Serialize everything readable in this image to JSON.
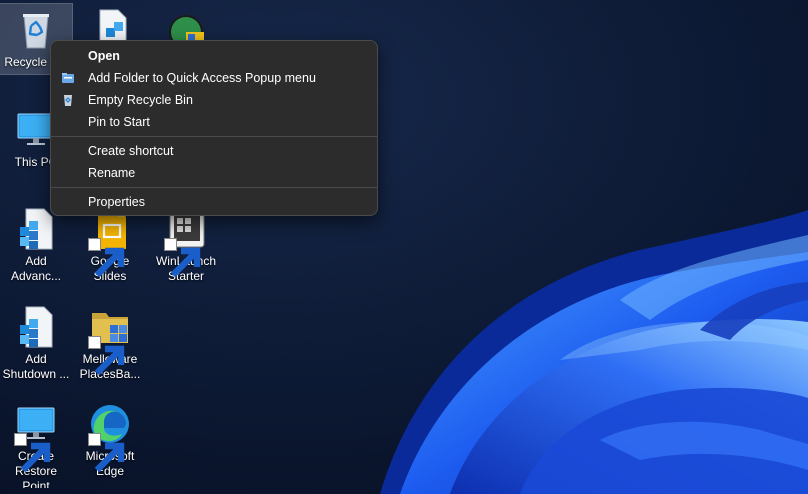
{
  "desktop": {
    "icons": [
      {
        "label": "Recycle Bin",
        "icon": "recycle-bin-icon",
        "shortcut": false
      },
      {
        "label": "This PC",
        "icon": "monitor-icon",
        "shortcut": false
      },
      {
        "label": "Add\nAdvanc...",
        "icon": "registry-file-icon",
        "shortcut": false
      },
      {
        "label": "Add\nShutdown ...",
        "icon": "registry-file-icon",
        "shortcut": false
      },
      {
        "label": "Create\nRestore Point",
        "icon": "monitor-icon",
        "shortcut": true
      },
      {
        "label": "",
        "icon": "registry-file-icon",
        "shortcut": false
      },
      {
        "label": "Google Slides",
        "icon": "google-slides-icon",
        "shortcut": true
      },
      {
        "label": "Melloware\nPlacesBa...",
        "icon": "folder-icon",
        "shortcut": true
      },
      {
        "label": "Microsoft\nEdge",
        "icon": "edge-icon",
        "shortcut": true
      },
      {
        "label": "",
        "icon": "app-globe-icon",
        "shortcut": false
      },
      {
        "label": "WinLaunch\nStarter",
        "icon": "winlaunch-icon",
        "shortcut": true
      }
    ]
  },
  "context_menu": {
    "items": [
      {
        "label": "Open",
        "icon": "",
        "bold": true
      },
      {
        "label": "Add Folder to Quick Access Popup menu",
        "icon": "quick-access-icon"
      },
      {
        "label": "Empty Recycle Bin",
        "icon": "recycle-bin-small-icon"
      },
      {
        "label": "Pin to Start",
        "icon": ""
      },
      {
        "label": "Create shortcut",
        "icon": ""
      },
      {
        "label": "Rename",
        "icon": ""
      },
      {
        "label": "Properties",
        "icon": ""
      }
    ]
  },
  "colors": {
    "wallpaper_dark": "#0b1630",
    "wallpaper_bloom": "#1d4ed8",
    "menu_bg": "#2c2c2c"
  }
}
